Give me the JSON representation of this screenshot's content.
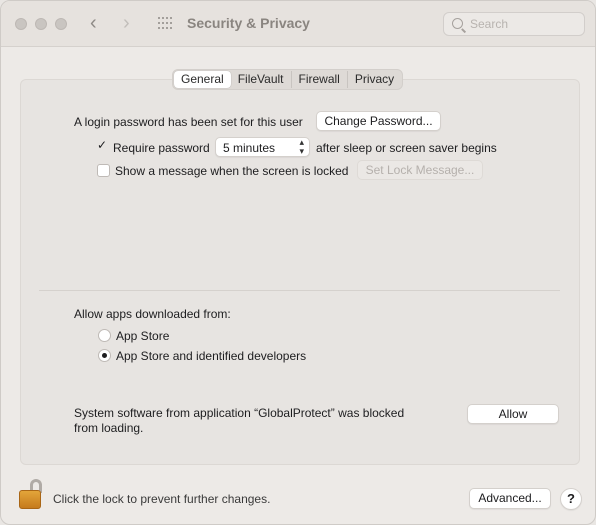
{
  "window": {
    "title": "Security & Privacy",
    "search_placeholder": "Search"
  },
  "tabs": [
    {
      "label": "General",
      "active": true
    },
    {
      "label": "FileVault",
      "active": false
    },
    {
      "label": "Firewall",
      "active": false
    },
    {
      "label": "Privacy",
      "active": false
    }
  ],
  "general": {
    "login_password_text": "A login password has been set for this user",
    "change_password_button": "Change Password...",
    "require_password_label": "Require password",
    "require_password_checked": true,
    "require_password_delay": "5 minutes",
    "after_sleep_text": "after sleep or screen saver begins",
    "show_message_label": "Show a message when the screen is locked",
    "show_message_checked": false,
    "set_lock_message_button": "Set Lock Message...",
    "allow_apps_label": "Allow apps downloaded from:",
    "app_sources": [
      {
        "label": "App Store",
        "selected": false
      },
      {
        "label": "App Store and identified developers",
        "selected": true
      }
    ],
    "blocked_text_line1": "System software from application “GlobalProtect” was blocked",
    "blocked_text_line2": "from loading.",
    "allow_button": "Allow"
  },
  "footer": {
    "lock_text": "Click the lock to prevent further changes.",
    "advanced_button": "Advanced...",
    "help_button": "?"
  }
}
